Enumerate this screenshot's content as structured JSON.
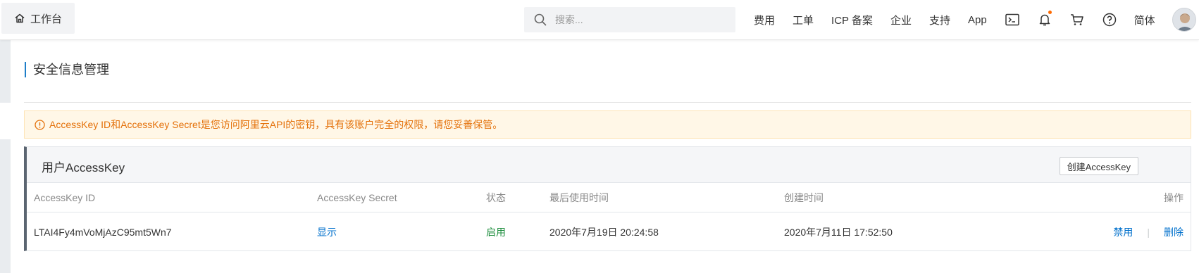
{
  "topbar": {
    "home_label": "工作台",
    "search": {
      "placeholder": "搜索..."
    },
    "nav": [
      "费用",
      "工单",
      "ICP 备案",
      "企业",
      "支持",
      "App"
    ],
    "icons": [
      "terminal-icon",
      "bell-icon",
      "cart-icon",
      "help-icon"
    ],
    "language": "简体"
  },
  "page": {
    "title": "安全信息管理",
    "alert": "AccessKey ID和AccessKey Secret是您访问阿里云API的密钥，具有该账户完全的权限，请您妥善保管。"
  },
  "panel": {
    "title": "用户AccessKey",
    "create_button": "创建AccessKey",
    "columns": [
      "AccessKey ID",
      "AccessKey Secret",
      "状态",
      "最后使用时间",
      "创建时间",
      "操作"
    ],
    "rows": [
      {
        "id": "LTAI4Fy4mVoMjAzC95mt5Wn7",
        "secret": "显示",
        "status": "启用",
        "last_used": "2020年7月19日 20:24:58",
        "created": "2020年7月11日 17:52:50",
        "action_disable": "禁用",
        "separator": "|",
        "action_delete": "删除"
      }
    ]
  },
  "colors": {
    "accent": "#0070cc",
    "alert_text": "#e4710a",
    "alert_bg": "#fff7e7",
    "status_ok": "#1e8e3e",
    "notify_dot": "#ff6a00"
  }
}
